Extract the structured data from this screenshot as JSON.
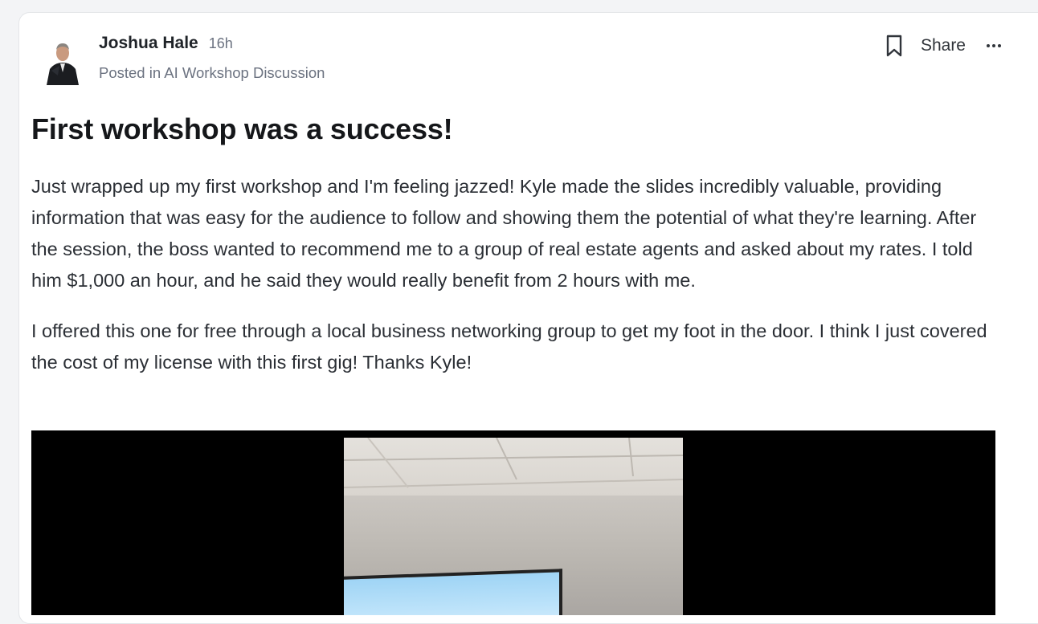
{
  "post": {
    "author": "Joshua Hale",
    "time": "16h",
    "posted_in": "Posted in AI Workshop Discussion",
    "title": "First workshop was a success!",
    "paragraphs": [
      "Just wrapped up my first workshop and I'm feeling jazzed! Kyle made the slides incredibly valuable, providing information that was easy for the audience to follow and showing them the potential of what they're learning. After the session, the boss wanted to recommend me to a group of real estate agents and asked about my rates. I told him $1,000 an hour, and he said they would really benefit from 2 hours with me.",
      "I offered this one for free through a local business networking group to get my foot in the door. I think I just covered the cost of my license with this first gig!  Thanks Kyle!"
    ]
  },
  "actions": {
    "bookmark_icon": "bookmark-icon",
    "share_label": "Share",
    "more_icon": "more-horizontal-icon"
  },
  "colors": {
    "text_primary": "#1f2328",
    "text_secondary": "#6b7280",
    "card_bg": "#ffffff",
    "page_bg": "#f3f4f6"
  }
}
